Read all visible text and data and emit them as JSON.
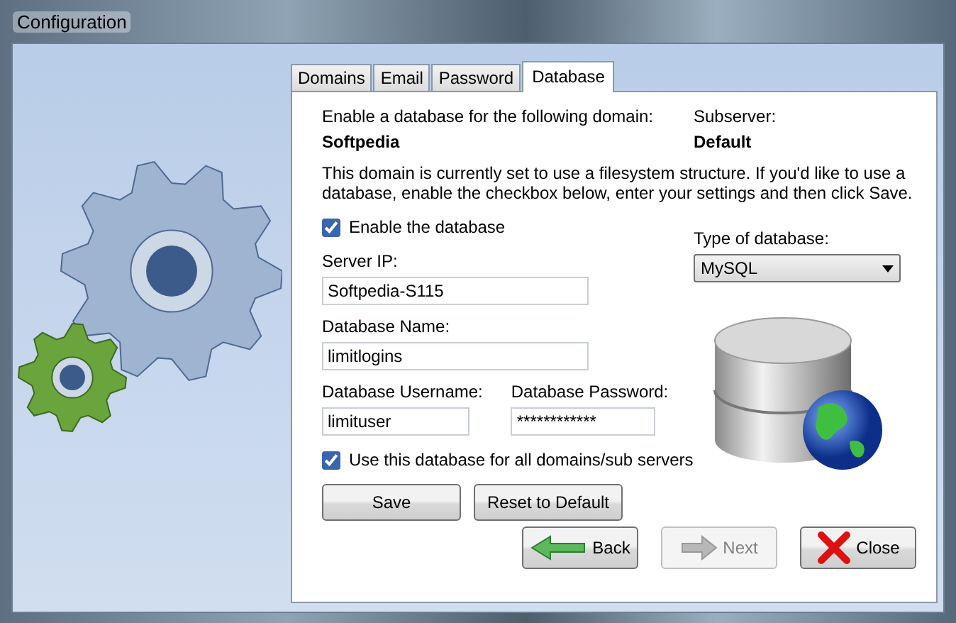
{
  "window": {
    "title": "Configuration"
  },
  "tabs": [
    {
      "label": "Domains",
      "selected": false
    },
    {
      "label": "Email",
      "selected": false
    },
    {
      "label": "Password",
      "selected": false
    },
    {
      "label": "Database",
      "selected": true
    }
  ],
  "domain": {
    "label": "Enable a database for the following domain:",
    "value": "Softpedia"
  },
  "subserver": {
    "label": "Subserver:",
    "value": "Default"
  },
  "description": "This domain is currently set to use a filesystem structure.  If you'd like to use a database, enable the checkbox below, enter your settings and then click Save.",
  "enable_database": {
    "label": "Enable the database",
    "checked": true
  },
  "fields": [
    {
      "label": "Server IP:",
      "value": "Softpedia-S115"
    },
    {
      "label": "Database Name:",
      "value": "limitlogins"
    },
    {
      "label": "Database Username:",
      "value": "limituser"
    },
    {
      "label": "Database Password:",
      "value": "************"
    }
  ],
  "use_for_all": {
    "label": "Use this database for all domains/sub servers",
    "checked": true
  },
  "type_of_database": {
    "label": "Type of database:",
    "value": "MySQL"
  },
  "form_buttons": [
    "Save",
    "Reset to Default"
  ],
  "nav_buttons": [
    {
      "label": "Back",
      "kind": "back",
      "disabled": false
    },
    {
      "label": "Next",
      "kind": "next",
      "disabled": true
    },
    {
      "label": "Close",
      "kind": "close",
      "disabled": false
    }
  ]
}
